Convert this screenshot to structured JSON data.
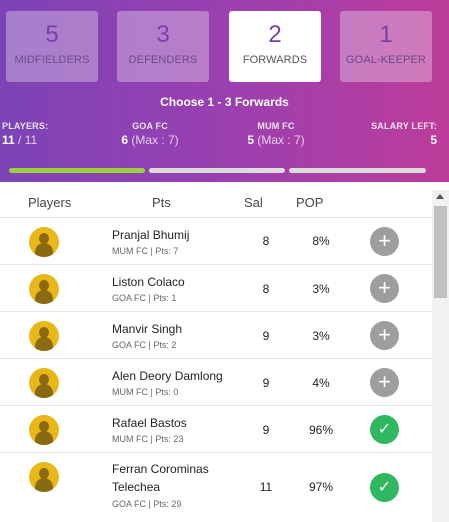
{
  "positions": [
    {
      "count": "5",
      "name": "MIDFIELDERS"
    },
    {
      "count": "3",
      "name": "DEFENDERS"
    },
    {
      "count": "2",
      "name": "FORWARDS"
    },
    {
      "count": "1",
      "name": "GOAL-KEEPER"
    }
  ],
  "active_position": "FORWARDS",
  "choose_text": "Choose 1 - 3 Forwards",
  "stats": {
    "players_label": "PLAYERS:",
    "players_value": "11",
    "players_total": "/ 11",
    "team1_label": "GOA FC",
    "team1_value": "6",
    "team1_max": "(Max : 7)",
    "team2_label": "MUM FC",
    "team2_value": "5",
    "team2_max": "(Max : 7)",
    "salary_label": "SALARY LEFT:",
    "salary_value": "5"
  },
  "progress": {
    "steps": 3,
    "completed": 1
  },
  "columns": {
    "players": "Players",
    "pts": "Pts",
    "sal": "Sal",
    "pop": "POP"
  },
  "players": [
    {
      "name_line1": "Pranjal Bhumij",
      "name_line2": "",
      "meta": "MUM FC | Pts: 7",
      "sal": "8",
      "pop": "8%",
      "selected": false,
      "action_icon": "+"
    },
    {
      "name_line1": "Liston Colaco",
      "name_line2": "",
      "meta": "GOA FC | Pts: 1",
      "sal": "8",
      "pop": "3%",
      "selected": false,
      "action_icon": "+"
    },
    {
      "name_line1": "Manvir Singh",
      "name_line2": "",
      "meta": "GOA FC | Pts: 2",
      "sal": "9",
      "pop": "3%",
      "selected": false,
      "action_icon": "+"
    },
    {
      "name_line1": "Alen Deory Damlong",
      "name_line2": "",
      "meta": "MUM FC | Pts: 0",
      "sal": "9",
      "pop": "4%",
      "selected": false,
      "action_icon": "+"
    },
    {
      "name_line1": "Rafael Bastos",
      "name_line2": "",
      "meta": "MUM FC | Pts: 23",
      "sal": "9",
      "pop": "96%",
      "selected": true,
      "action_icon": "✓"
    },
    {
      "name_line1": "Ferran Corominas",
      "name_line2": "Telechea",
      "meta": "GOA FC | Pts: 29",
      "sal": "11",
      "pop": "97%",
      "selected": true,
      "action_icon": "✓"
    }
  ],
  "colors": {
    "accent_purple": "#9a40b0",
    "progress_done": "#9ccf3c",
    "selected_green": "#2fb85f",
    "add_grey": "#9e9e9e"
  }
}
